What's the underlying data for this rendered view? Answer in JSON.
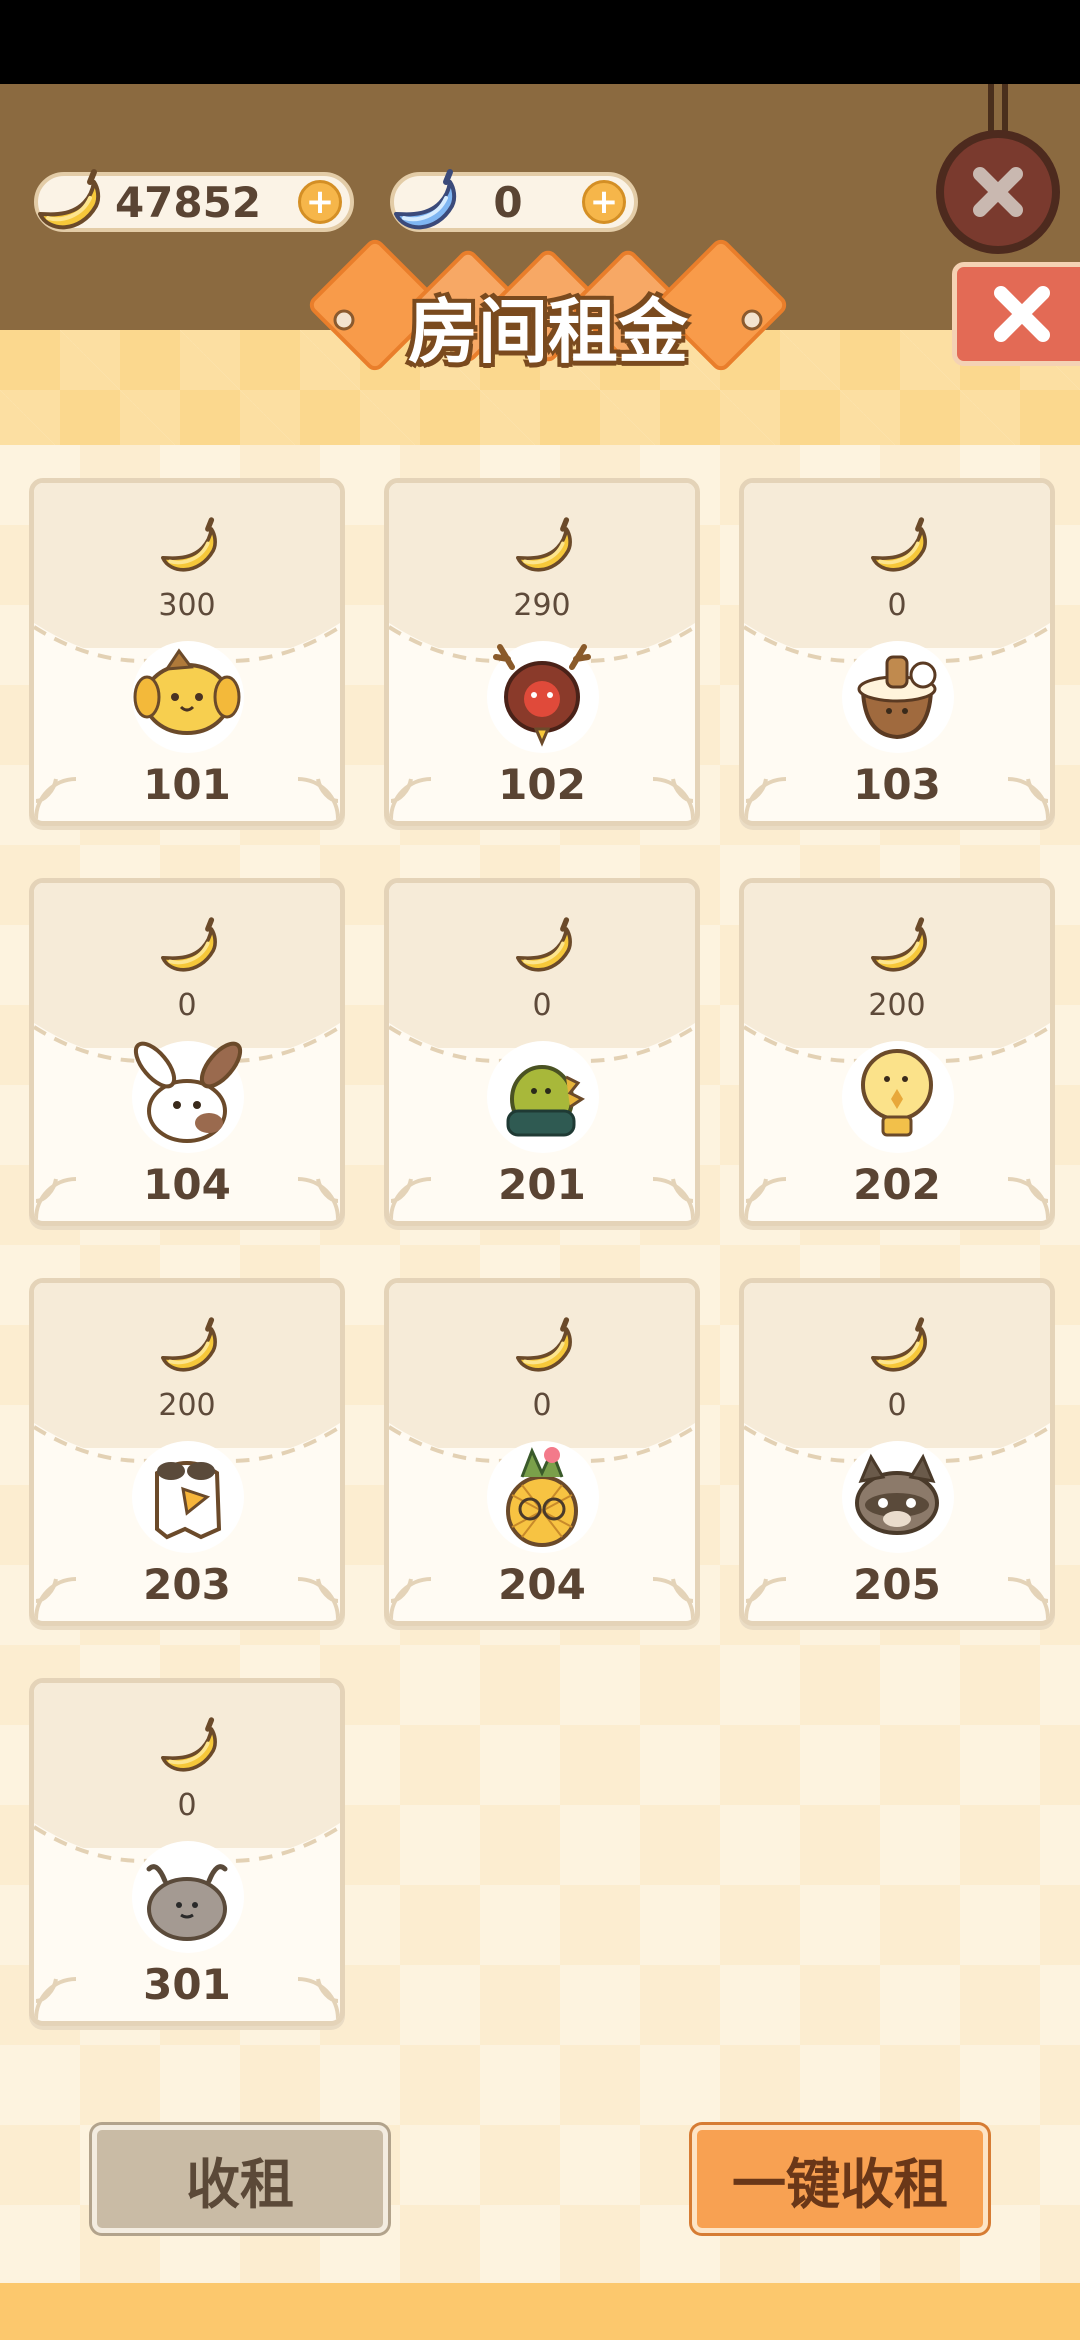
{
  "currency": {
    "banana_amount": "47852",
    "gem_amount": "0"
  },
  "title": "房间租金",
  "rooms": [
    {
      "rent": "300",
      "room": "101",
      "avatar": "pudding-dog"
    },
    {
      "rent": "290",
      "room": "102",
      "avatar": "reindeer"
    },
    {
      "rent": "0",
      "room": "103",
      "avatar": "pudding-bowl"
    },
    {
      "rent": "0",
      "room": "104",
      "avatar": "bunny"
    },
    {
      "rent": "0",
      "room": "201",
      "avatar": "dino"
    },
    {
      "rent": "200",
      "room": "202",
      "avatar": "lightbulb"
    },
    {
      "rent": "200",
      "room": "203",
      "avatar": "bird"
    },
    {
      "rent": "0",
      "room": "204",
      "avatar": "pineapple"
    },
    {
      "rent": "0",
      "room": "205",
      "avatar": "raccoon"
    },
    {
      "rent": "0",
      "room": "301",
      "avatar": "grey-bug"
    }
  ],
  "buttons": {
    "collect": "收租",
    "collect_all": "一键收租"
  },
  "colors": {
    "accent_orange": "#f8a152",
    "banana_yellow": "#f7c83c",
    "header_brown": "#8b6a40"
  }
}
